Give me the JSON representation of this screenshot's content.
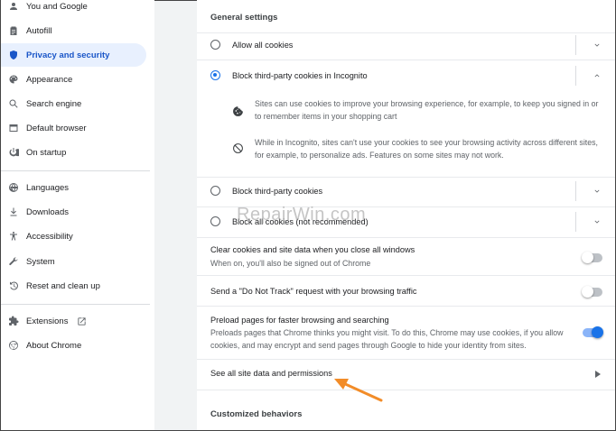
{
  "sidebar": {
    "items": [
      {
        "label": "You and Google",
        "icon": "person-icon"
      },
      {
        "label": "Autofill",
        "icon": "clipboard-icon"
      },
      {
        "label": "Privacy and security",
        "icon": "shield-icon"
      },
      {
        "label": "Appearance",
        "icon": "palette-icon"
      },
      {
        "label": "Search engine",
        "icon": "search-icon"
      },
      {
        "label": "Default browser",
        "icon": "browser-icon"
      },
      {
        "label": "On startup",
        "icon": "power-icon"
      },
      {
        "label": "Languages",
        "icon": "globe-icon"
      },
      {
        "label": "Downloads",
        "icon": "download-icon"
      },
      {
        "label": "Accessibility",
        "icon": "accessibility-icon"
      },
      {
        "label": "System",
        "icon": "wrench-icon"
      },
      {
        "label": "Reset and clean up",
        "icon": "history-icon"
      },
      {
        "label": "Extensions",
        "icon": "puzzle-icon"
      },
      {
        "label": "About Chrome",
        "icon": "chrome-icon"
      }
    ],
    "active_index": 2
  },
  "main": {
    "general_settings_title": "General settings",
    "options": {
      "allow_all": "Allow all cookies",
      "block_incognito": "Block third-party cookies in Incognito",
      "block_incognito_detail_1": "Sites can use cookies to improve your browsing experience, for example, to keep you signed in or to remember items in your shopping cart",
      "block_incognito_detail_2": "While in Incognito, sites can't use your cookies to see your browsing activity across different sites, for example, to personalize ads. Features on some sites may not work.",
      "block_third_party": "Block third-party cookies",
      "block_all": "Block all cookies (not recommended)"
    },
    "clear_on_exit": {
      "label": "Clear cookies and site data when you close all windows",
      "sub": "When on, you'll also be signed out of Chrome",
      "enabled": false
    },
    "do_not_track": {
      "label": "Send a \"Do Not Track\" request with your browsing traffic",
      "enabled": false
    },
    "preload": {
      "label": "Preload pages for faster browsing and searching",
      "sub": "Preloads pages that Chrome thinks you might visit. To do this, Chrome may use cookies, if you allow cookies, and may encrypt and send pages through Google to hide your identity from sites.",
      "enabled": true
    },
    "see_all_label": "See all site data and permissions",
    "customized_title": "Customized behaviors"
  },
  "watermark": "RepairWin.com",
  "colors": {
    "accent": "#1a73e8",
    "active_bg": "#e8f0fe",
    "annotation": "#f28c28"
  }
}
